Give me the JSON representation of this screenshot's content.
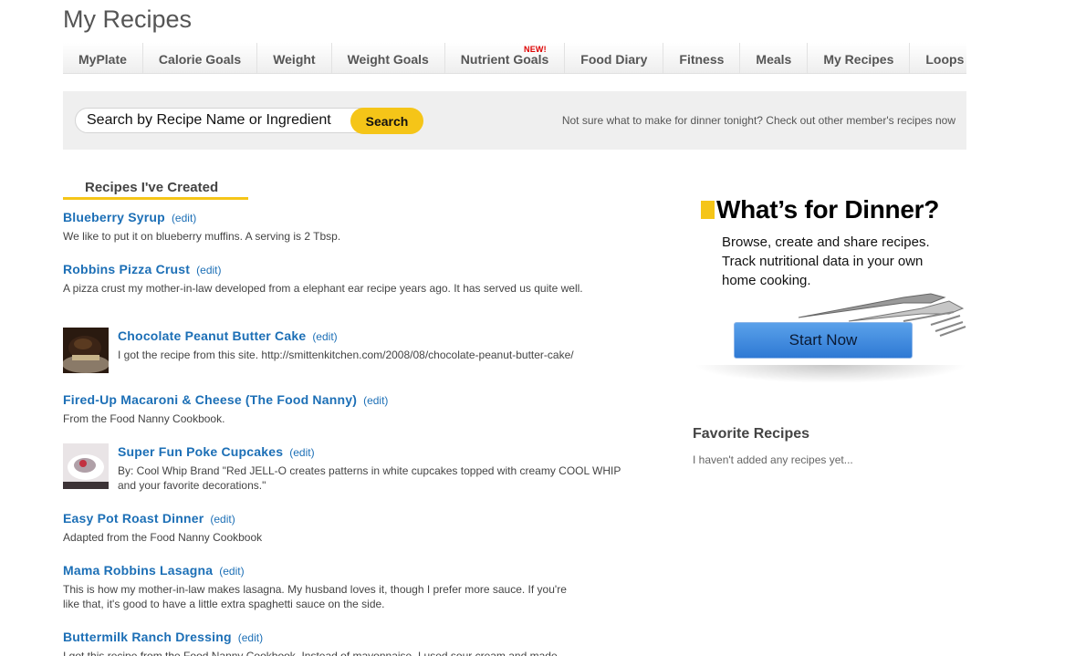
{
  "page": {
    "title": "My Recipes"
  },
  "nav": {
    "items": [
      {
        "label": "MyPlate"
      },
      {
        "label": "Calorie Goals"
      },
      {
        "label": "Weight"
      },
      {
        "label": "Weight Goals"
      },
      {
        "label": "Nutrient Goals",
        "badge": "NEW!"
      },
      {
        "label": "Food Diary"
      },
      {
        "label": "Fitness"
      },
      {
        "label": "Meals"
      },
      {
        "label": "My Recipes"
      },
      {
        "label": "Loops"
      }
    ]
  },
  "search": {
    "placeholder": "Search by Recipe Name or Ingredient",
    "button_label": "Search",
    "promo_text": "Not sure what to make for dinner tonight? Check out other member's recipes now"
  },
  "recipes_section": {
    "header": "Recipes I've Created",
    "edit_label": "(edit)",
    "items": [
      {
        "name": "Blueberry Syrup",
        "description": "We like to put it on blueberry muffins. A serving is 2 Tbsp."
      },
      {
        "name": "Robbins Pizza Crust",
        "description": "A pizza crust my mother-in-law developed from a elephant ear recipe years ago. It has served us quite well."
      },
      {
        "name": "Chocolate Peanut Butter Cake",
        "description": "I got the recipe from this site. http://smittenkitchen.com/2008/08/chocolate-peanut-butter-cake/"
      },
      {
        "name": "Fired-Up Macaroni & Cheese (The Food Nanny)",
        "description": "From the Food Nanny Cookbook."
      },
      {
        "name": "Super Fun Poke Cupcakes",
        "description": "By: Cool Whip Brand \"Red JELL-O creates patterns in white cupcakes topped with creamy COOL WHIP and your favorite decorations.\""
      },
      {
        "name": "Easy Pot Roast Dinner",
        "description": "Adapted from the Food Nanny Cookbook"
      },
      {
        "name": "Mama Robbins Lasagna",
        "description": "This is how my mother-in-law makes lasagna. My husband loves it, though I prefer more sauce. If you're like that, it's good to have a little extra spaghetti sauce on the side."
      },
      {
        "name": "Buttermilk Ranch Dressing",
        "description": "I got this recipe from the Food Nanny Cookbook. Instead of mayonnaise, I used sour cream and made"
      }
    ]
  },
  "ad": {
    "title": "What’s for Dinner?",
    "body": "Browse, create and share recipes.  Track nutritional data in your own home cooking.",
    "button_label": "Start Now"
  },
  "favorites": {
    "title": "Favorite Recipes",
    "empty_text": "I haven't added any recipes yet..."
  },
  "colors": {
    "accent": "#f5c518",
    "link": "#1c6fb6",
    "button_blue": "#3a86dd"
  }
}
